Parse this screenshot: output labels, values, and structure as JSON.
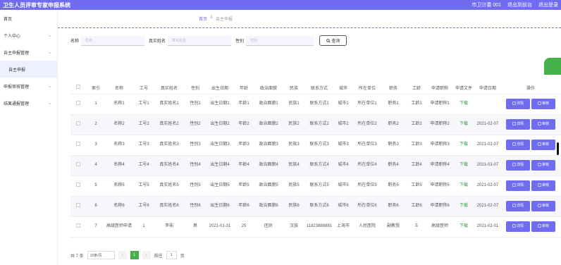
{
  "header": {
    "title": "卫生人员评审专家申报系统",
    "user": "市卫计委 001",
    "back": "退出到前台",
    "logout": "退出登录"
  },
  "sidebar": {
    "items": [
      {
        "label": "首页",
        "arrow": ""
      },
      {
        "label": "个人中心",
        "arrow": "⌄"
      },
      {
        "label": "自主申报管理",
        "arrow": "⌄"
      },
      {
        "label": "自主申报",
        "arrow": "",
        "sub": true
      },
      {
        "label": "申报审核管理",
        "arrow": "⌄"
      },
      {
        "label": "结果通报管理",
        "arrow": "⌄"
      }
    ]
  },
  "breadcrumb": {
    "home": "首页",
    "sep": "&",
    "current": "自主申报"
  },
  "search": {
    "name_label": "名称",
    "name_placeholder": "名称",
    "realname_label": "真实姓名",
    "realname_placeholder": "真实姓名",
    "gender_label": "性别",
    "gender_placeholder": "性别",
    "button": "查询"
  },
  "table": {
    "headers": [
      "",
      "索引",
      "名称",
      "工号",
      "真实姓名",
      "性别",
      "出生日期",
      "年龄",
      "政治面貌",
      "民族",
      "联系方式",
      "城市",
      "所在单位",
      "职务",
      "工龄",
      "申请职称",
      "申请文件",
      "申请日期",
      "操作"
    ],
    "rows": [
      [
        "1",
        "名称1",
        "工号1",
        "真实姓名1",
        "性别1",
        "出生日期1",
        "年龄1",
        "政治面貌1",
        "民族1",
        "联系方式1",
        "城市1",
        "所在单位1",
        "职务1",
        "工龄1",
        "申请职称1",
        "下载",
        "",
        ""
      ],
      [
        "2",
        "名称2",
        "工号2",
        "真实姓名2",
        "性别2",
        "出生日期2",
        "年龄2",
        "政治面貌2",
        "民族2",
        "联系方式2",
        "城市2",
        "所在单位2",
        "职务2",
        "工龄2",
        "申请职称2",
        "下载",
        "2021-02-07",
        ""
      ],
      [
        "3",
        "名称3",
        "工号3",
        "真实姓名3",
        "性别3",
        "出生日期3",
        "年龄3",
        "政治面貌3",
        "民族3",
        "联系方式3",
        "城市3",
        "所在单位3",
        "职务3",
        "工龄3",
        "申请职称3",
        "下载",
        "2021-02-07",
        ""
      ],
      [
        "4",
        "名称4",
        "工号4",
        "真实姓名4",
        "性别4",
        "出生日期4",
        "年龄4",
        "政治面貌4",
        "民族4",
        "联系方式4",
        "城市4",
        "所在单位4",
        "职务4",
        "工龄4",
        "申请职称4",
        "下载",
        "2021-02-07",
        ""
      ],
      [
        "5",
        "名称5",
        "工号5",
        "真实姓名5",
        "性别5",
        "出生日期5",
        "年龄5",
        "政治面貌5",
        "民族5",
        "联系方式5",
        "城市5",
        "所在单位5",
        "职务5",
        "工龄5",
        "申请职称5",
        "下载",
        "2021-02-07",
        ""
      ],
      [
        "6",
        "名称6",
        "工号6",
        "真实姓名6",
        "性别6",
        "出生日期6",
        "年龄6",
        "政治面貌6",
        "民族6",
        "联系方式6",
        "城市6",
        "所在单位6",
        "职务6",
        "工龄6",
        "申请职称6",
        "下载",
        "2021-02-07",
        ""
      ],
      [
        "7",
        "高级医师申请",
        "1",
        "李祐",
        "男",
        "2021-01-31",
        "25",
        "团员",
        "汉族",
        "11823888881",
        "上海市",
        "人民医院",
        "副教授",
        "5",
        "高级医师",
        "下载",
        "2021-02-01",
        ""
      ]
    ],
    "detail_btn": "详情",
    "review_btn": "审核"
  },
  "pager": {
    "total": "共 7 条",
    "page_size": "10条/页",
    "prev": "‹",
    "current": "1",
    "next": "›",
    "goto": "前往",
    "goto_value": "1",
    "page_unit": "页"
  },
  "colors": {
    "accent": "#6f6cf0",
    "green": "#43b049"
  }
}
